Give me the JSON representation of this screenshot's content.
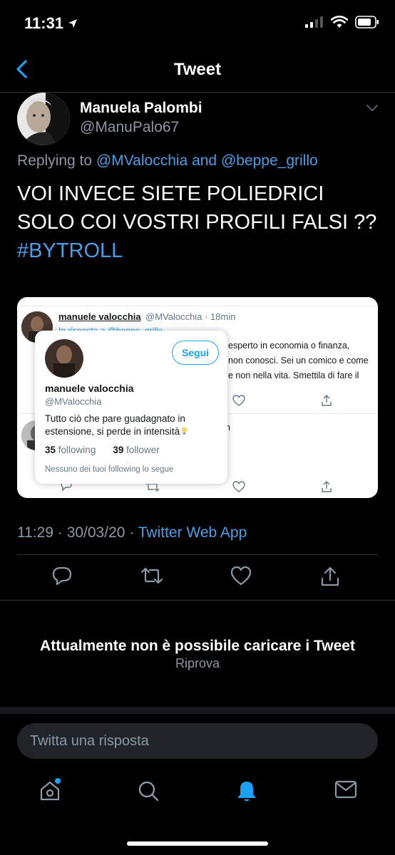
{
  "status_bar": {
    "time": "11:31"
  },
  "nav": {
    "title": "Tweet"
  },
  "tweet": {
    "author_name": "Manuela Palombi",
    "author_handle": "@ManuPalo67",
    "replying_prefix": "Replying to",
    "reply_handle_1": "@MValocchia",
    "reply_and": "and",
    "reply_handle_2": "@beppe_grillo",
    "text_line_1": "VOI INVECE SIETE POLIEDRICI",
    "text_line_2": "SOLO COI VOSTRI PROFILI FALSI ??",
    "hashtag": "#BYTROLL",
    "time": "11:29",
    "date": "30/03/20",
    "source": "Twitter Web App"
  },
  "embedded_screenshot": {
    "behind_tweet": {
      "name": "manuele valocchia",
      "handle": "@MValocchia",
      "age": "18min",
      "reply_to": "In risposta a @beppe_grillo",
      "body_line_1": "esperto in economia o finanza,",
      "body_line_2": "non conosci. Sei un comico e come",
      "body_line_3": "e non nella vita. Smettila di fare il",
      "second_fragment": "n"
    },
    "hover_card": {
      "follow_label": "Segui",
      "name": "manuele valocchia",
      "handle": "@MValocchia",
      "bio_line_1": "Tutto ciò che pare guadagnato in",
      "bio_line_2": "estensione, si perde in intensità",
      "following_count": "35",
      "following_label": "following",
      "follower_count": "39",
      "follower_label": "follower",
      "mutual_note": "Nessuno dei tuoi following lo segue"
    }
  },
  "error": {
    "title": "Attualmente non è possibile caricare i Tweet",
    "retry_label": "Riprova"
  },
  "compose": {
    "placeholder": "Twitta una risposta"
  },
  "colors": {
    "accent": "#1da1f2",
    "link": "#4a9ee6",
    "muted": "#8b98a5",
    "background": "#000000"
  },
  "tab_bar": {
    "icons": [
      "home-icon",
      "search-icon",
      "notifications-bell-icon",
      "messages-envelope-icon"
    ],
    "active": "notifications-bell-icon"
  }
}
